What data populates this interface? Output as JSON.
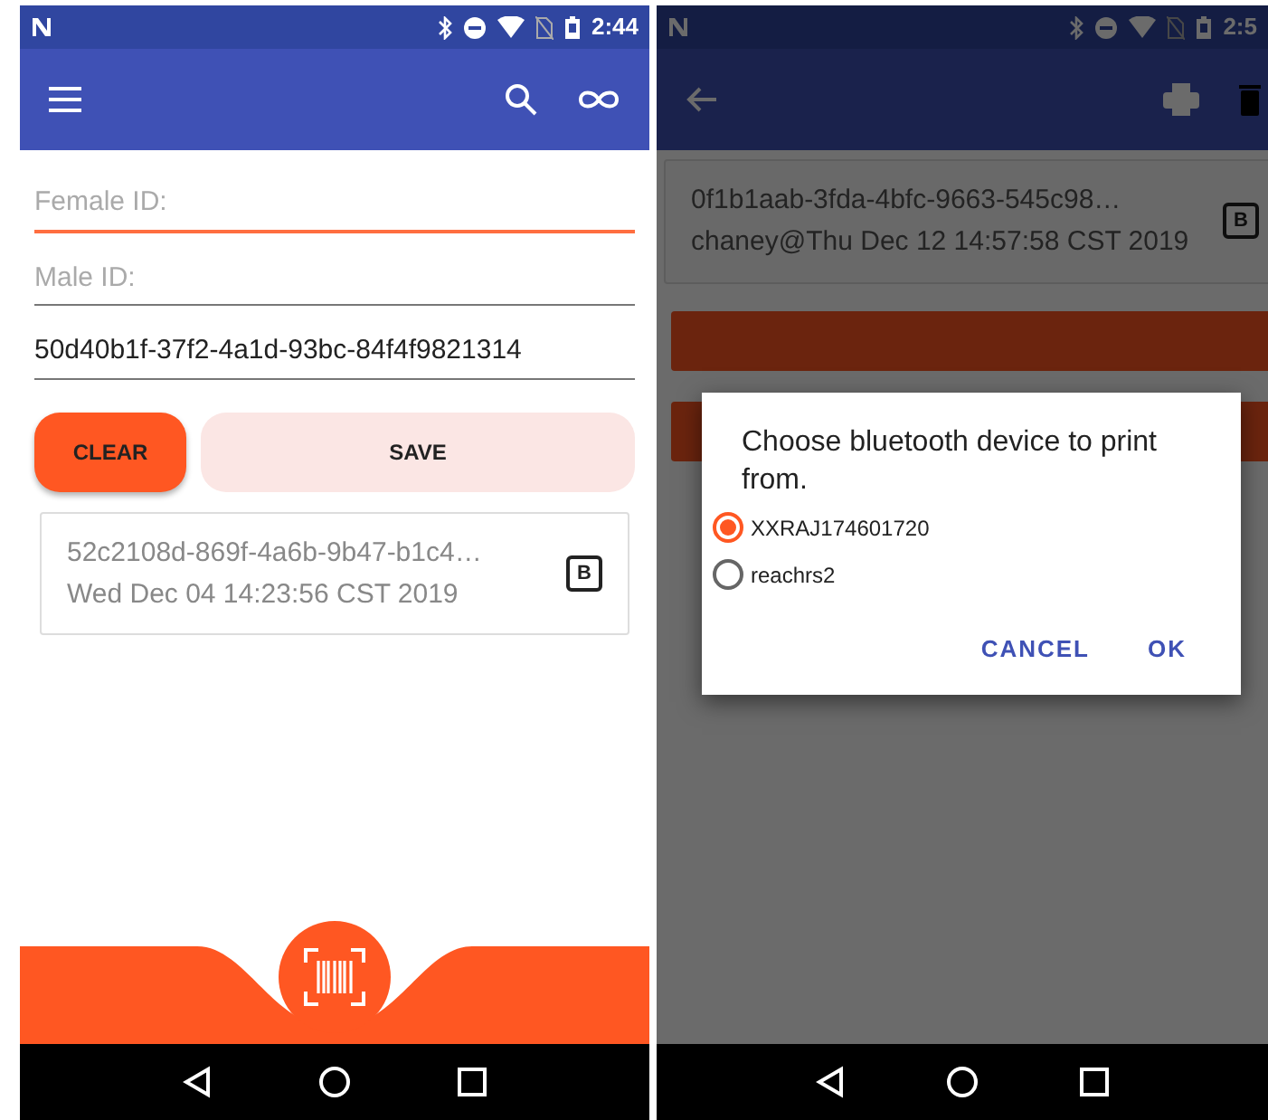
{
  "left": {
    "status_bar": {
      "time": "2:44"
    },
    "fields": [
      {
        "placeholder": "Female ID:",
        "focused": true
      },
      {
        "placeholder": "Male ID:",
        "focused": false
      },
      {
        "value": "50d40b1f-37f2-4a1d-93bc-84f4f9821314",
        "focused": false
      }
    ],
    "buttons": [
      {
        "label": "CLEAR",
        "kind": "primary"
      },
      {
        "label": "SAVE",
        "kind": "secondary"
      }
    ],
    "records": [
      {
        "id": "52c2108d-869f-4a6b-9b47-b1c4…",
        "detail": "Wed Dec 04 14:23:56 CST 2019",
        "badge": "B"
      }
    ]
  },
  "right": {
    "status_bar": {
      "time": "2:5"
    },
    "records": [
      {
        "id": "0f1b1aab-3fda-4bfc-9663-545c98…",
        "detail": "chaney@Thu Dec 12 14:57:58 CST 2019",
        "badge": "B"
      }
    ],
    "dialog": {
      "title": "Choose bluetooth device to print from.",
      "options": [
        {
          "label": "XXRAJ174601720",
          "selected": true
        },
        {
          "label": "reachrs2",
          "selected": false
        }
      ],
      "actions": [
        "CANCEL",
        "OK"
      ]
    }
  }
}
